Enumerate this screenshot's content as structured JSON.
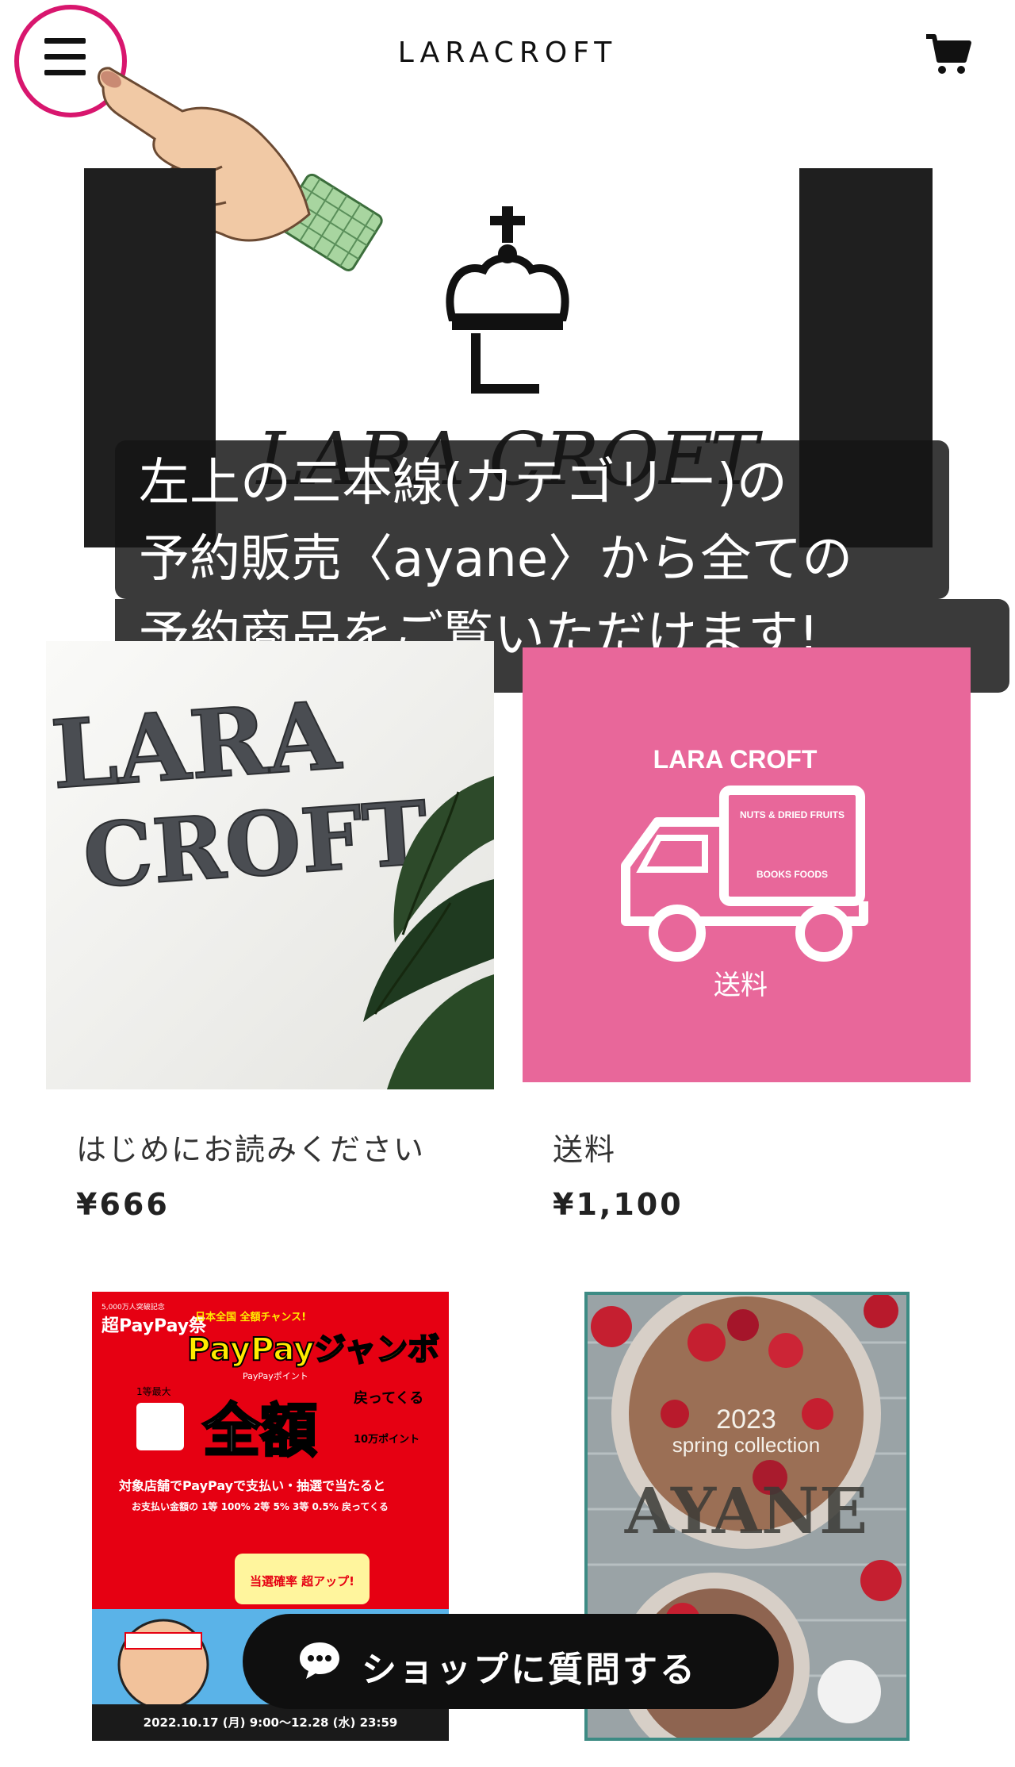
{
  "header": {
    "brand": "LARACROFT",
    "menu_icon": "hamburger-menu-icon",
    "cart_icon": "shopping-cart-icon"
  },
  "hero": {
    "logo_text": "LARA CROFT",
    "callout_lines": [
      "左上の三本線(カテゴリー)の",
      "予約販売〈ayane〉から全ての",
      "予約商品をご覧いただけます!"
    ]
  },
  "products": [
    {
      "name": "はじめにお読みください",
      "price": "¥666",
      "image_text": [
        "LARA",
        "CROFT"
      ]
    },
    {
      "name": "送料",
      "price": "¥1,100",
      "image_text": [
        "LARA CROFT",
        "NUTS & DRIED FRUITS",
        "BOOKS FOODS",
        "送料"
      ]
    },
    {
      "name": "",
      "price": "",
      "image_text": [
        "5,000万人突破記念",
        "超PayPay祭",
        "日本全国 全額チャンス!",
        "PayPayジャンボ",
        "PayPayポイント",
        "1等最大",
        "全額",
        "戻ってくる",
        "10万ポイント",
        "対象店舗でPayPayで支払い・抽選で当たると",
        "お支払い金額の 1等 100% 2等 5% 3等 0.5% 戻ってくる",
        "当選確率 超アップ!",
        "2022.10.17 (月) 9:00〜12.28 (水) 23:59"
      ]
    },
    {
      "name": "",
      "price": "",
      "image_text": [
        "2023",
        "spring collection",
        "AYANE"
      ]
    }
  ],
  "chat": {
    "label": "ショップに質問する",
    "icon": "chat-bubble-icon"
  },
  "colors": {
    "accent_ring": "#d8166e",
    "shipping_pink": "#e8679a",
    "paypay_red": "#e60012"
  }
}
